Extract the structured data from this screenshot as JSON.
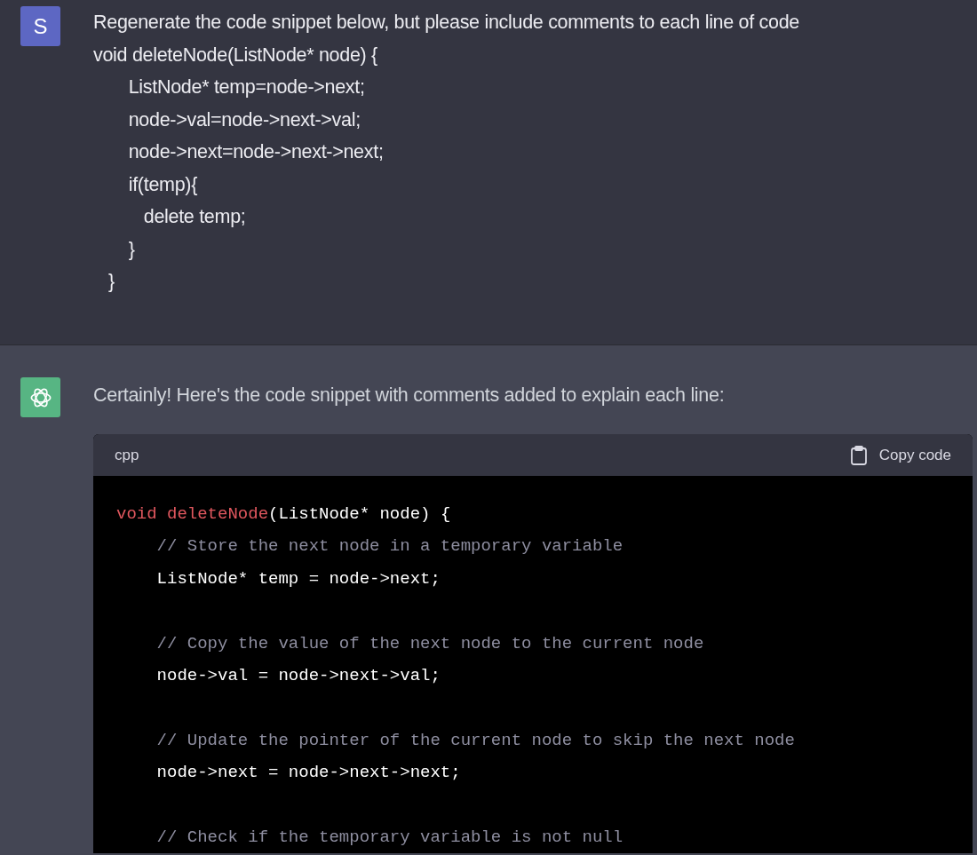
{
  "messages": [
    {
      "kind": "user",
      "avatar": "S",
      "lines": [
        "Regenerate the code snippet below, but please include comments to each line of code",
        "void deleteNode(ListNode* node) {",
        "       ListNode* temp=node->next;",
        "       node->val=node->next->val;",
        "       node->next=node->next->next;",
        "       if(temp){",
        "          delete temp;",
        "       }",
        "   }"
      ]
    },
    {
      "kind": "assistant",
      "text": "Certainly! Here's the code snippet with comments added to explain each line:",
      "code": {
        "language": "cpp",
        "copy_label": "Copy code",
        "lines": [
          {
            "kind": "code",
            "tokens": [
              {
                "kind": "keyword",
                "text": "void "
              },
              {
                "kind": "function",
                "text": "deleteNode"
              },
              {
                "kind": "plain",
                "text": "(ListNode* node) {"
              }
            ]
          },
          {
            "kind": "code",
            "tokens": [
              {
                "kind": "comment",
                "text": "    // Store the next node in a temporary variable"
              }
            ]
          },
          {
            "kind": "code",
            "tokens": [
              {
                "kind": "plain",
                "text": "    ListNode* temp = node->next;"
              }
            ]
          },
          {
            "kind": "blank"
          },
          {
            "kind": "code",
            "tokens": [
              {
                "kind": "comment",
                "text": "    // Copy the value of the next node to the current node"
              }
            ]
          },
          {
            "kind": "code",
            "tokens": [
              {
                "kind": "plain",
                "text": "    node->val = node->next->val;"
              }
            ]
          },
          {
            "kind": "blank"
          },
          {
            "kind": "code",
            "tokens": [
              {
                "kind": "comment",
                "text": "    // Update the pointer of the current node to skip the next node"
              }
            ]
          },
          {
            "kind": "code",
            "tokens": [
              {
                "kind": "plain",
                "text": "    node->next = node->next->next;"
              }
            ]
          },
          {
            "kind": "blank"
          },
          {
            "kind": "code",
            "tokens": [
              {
                "kind": "comment",
                "text": "    // Check if the temporary variable is not null"
              }
            ]
          }
        ]
      }
    }
  ]
}
